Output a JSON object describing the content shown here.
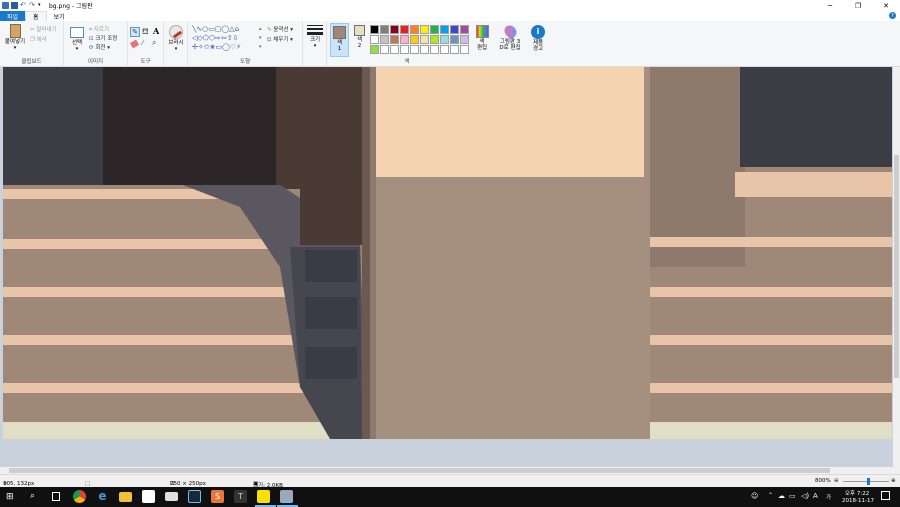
{
  "window": {
    "title": "bg.png - 그림판",
    "controls": [
      "─",
      "❐",
      "✕"
    ]
  },
  "tabs": {
    "file": "파일",
    "home": "홈",
    "view": "보기"
  },
  "ribbon": {
    "clipboard": {
      "paste": "붙여넣기",
      "cut": "잘라내기",
      "copy": "복사",
      "label": "클립보드"
    },
    "image": {
      "select": "선택",
      "crop": "자르기",
      "resize": "크기 조정",
      "rotate": "회전",
      "label": "이미지"
    },
    "tools": {
      "label": "도구"
    },
    "brushes": {
      "label": "브러시"
    },
    "shapes": {
      "outline": "윤곽선",
      "fill": "채우기",
      "label": "도형"
    },
    "size": {
      "label": "크기"
    },
    "colors": {
      "color1": "색\n1",
      "color1_a": "색",
      "color1_b": "1",
      "color2_a": "색",
      "color2_b": "2",
      "edit_a": "색",
      "edit_b": "편집",
      "paint3d_a": "그림판 3",
      "paint3d_b": "D로 편집",
      "notice_a": "제품",
      "notice_b": "경고",
      "label": "색",
      "color1_value": "#a08878",
      "color2_value": "#e4e0c4",
      "palette_row1": [
        "#000000",
        "#7f7f7f",
        "#880015",
        "#ed1c24",
        "#ff7f27",
        "#fff200",
        "#22b14c",
        "#00a2e8",
        "#3f48cc",
        "#a349a4"
      ],
      "palette_row2": [
        "#ffffff",
        "#c3c3c3",
        "#b97a57",
        "#ffaec9",
        "#ffc90e",
        "#efe4b0",
        "#b5e61d",
        "#99d9ea",
        "#7092be",
        "#c8bfe7"
      ],
      "palette_row3": [
        "#8ee04a",
        "#ffffff",
        "#ffffff",
        "#ffffff",
        "#ffffff",
        "#ffffff",
        "#ffffff",
        "#ffffff",
        "#ffffff",
        "#ffffff"
      ]
    }
  },
  "status": {
    "cursor": "105, 132px",
    "selection": "",
    "canvas_size": "250 × 250px",
    "file_size": "크기: 2.0KB",
    "zoom": "800%",
    "zoom_fraction": 0.55
  },
  "taskbar": {
    "time": "오후 7:22",
    "date": "2018-11-17",
    "ime": "A",
    "lang": "가"
  }
}
